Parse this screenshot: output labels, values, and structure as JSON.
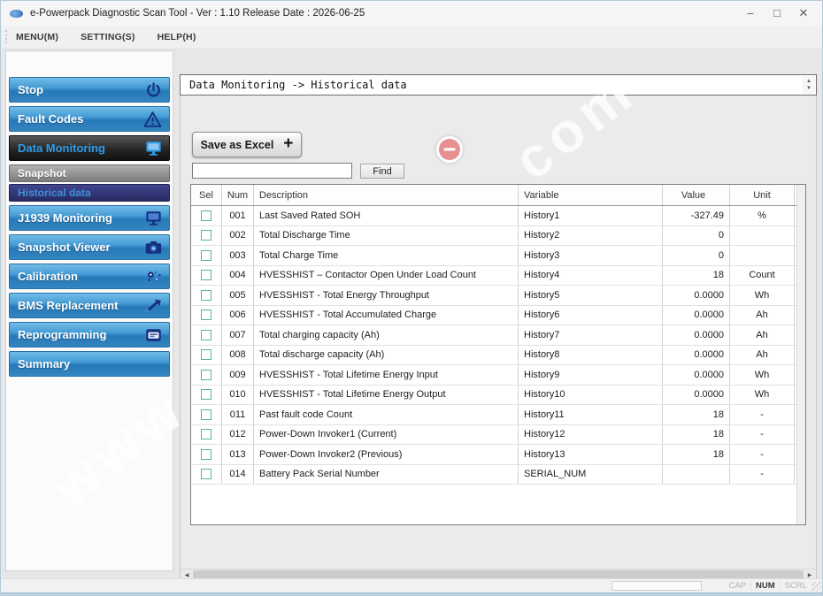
{
  "window": {
    "title": "e-Powerpack Diagnostic Scan Tool - Ver : 1.10 Release Date : 2026-06-25",
    "controls": {
      "minimize": "–",
      "maximize": "□",
      "close": "✕"
    }
  },
  "menu": {
    "items": [
      {
        "label": "MENU(M)"
      },
      {
        "label": "SETTING(S)"
      },
      {
        "label": "HELP(H)"
      }
    ]
  },
  "sidebar": {
    "items": [
      {
        "label": "Stop",
        "icon": "power-icon",
        "style": "blue",
        "selected": false
      },
      {
        "label": "Fault Codes",
        "icon": "warning-triangle-icon",
        "style": "blue",
        "selected": false
      },
      {
        "label": "Data Monitoring",
        "icon": "monitor-icon",
        "style": "dark-selected",
        "selected": true
      },
      {
        "label": "Snapshot",
        "icon": "",
        "style": "sub-gray",
        "selected": false
      },
      {
        "label": "Historical data",
        "icon": "",
        "style": "sub-navy-selected",
        "selected": true
      },
      {
        "label": "J1939 Monitoring",
        "icon": "monitor-icon",
        "style": "blue",
        "selected": false
      },
      {
        "label": "Snapshot Viewer",
        "icon": "camera-icon",
        "style": "blue",
        "selected": false
      },
      {
        "label": "Calibration",
        "icon": "gears-icon",
        "style": "blue",
        "selected": false
      },
      {
        "label": "BMS Replacement",
        "icon": "swap-arrows-icon",
        "style": "blue",
        "selected": false
      },
      {
        "label": "Reprogramming",
        "icon": "file-icon",
        "style": "blue",
        "selected": false
      },
      {
        "label": "Summary",
        "icon": "",
        "style": "blue",
        "selected": false
      }
    ]
  },
  "main": {
    "breadcrumb": "Data Monitoring -> Historical data",
    "save_button": {
      "label": "Save as Excel",
      "plus": "+"
    },
    "find": {
      "value": "",
      "button_label": "Find"
    },
    "annotation_badge": {
      "symbol": "minus"
    },
    "table": {
      "columns": [
        "Sel",
        "Num",
        "Description",
        "Variable",
        "Value",
        "Unit"
      ],
      "rows": [
        {
          "sel": false,
          "num": "001",
          "description": "Last Saved Rated SOH",
          "variable": "History1",
          "value": "-327.49",
          "unit": "%"
        },
        {
          "sel": false,
          "num": "002",
          "description": "Total Discharge Time",
          "variable": "History2",
          "value": "0",
          "unit": ""
        },
        {
          "sel": false,
          "num": "003",
          "description": "Total Charge Time",
          "variable": "History3",
          "value": "0",
          "unit": ""
        },
        {
          "sel": false,
          "num": "004",
          "description": "HVESSHIST – Contactor Open Under Load Count",
          "variable": "History4",
          "value": "18",
          "unit": "Count"
        },
        {
          "sel": false,
          "num": "005",
          "description": "HVESSHIST - Total Energy Throughput",
          "variable": "History5",
          "value": "0.0000",
          "unit": "Wh"
        },
        {
          "sel": false,
          "num": "006",
          "description": "HVESSHIST - Total Accumulated Charge",
          "variable": "History6",
          "value": "0.0000",
          "unit": "Ah"
        },
        {
          "sel": false,
          "num": "007",
          "description": "Total charging capacity (Ah)",
          "variable": "History7",
          "value": "0.0000",
          "unit": "Ah"
        },
        {
          "sel": false,
          "num": "008",
          "description": "Total discharge capacity (Ah)",
          "variable": "History8",
          "value": "0.0000",
          "unit": "Ah"
        },
        {
          "sel": false,
          "num": "009",
          "description": "HVESSHIST - Total Lifetime Energy Input",
          "variable": "History9",
          "value": "0.0000",
          "unit": "Wh"
        },
        {
          "sel": false,
          "num": "010",
          "description": "HVESSHIST - Total Lifetime Energy Output",
          "variable": "History10",
          "value": "0.0000",
          "unit": "Wh"
        },
        {
          "sel": false,
          "num": "011",
          "description": "Past fault code Count",
          "variable": "History11",
          "value": "18",
          "unit": "-"
        },
        {
          "sel": false,
          "num": "012",
          "description": "Power-Down Invoker1 (Current)",
          "variable": "History12",
          "value": "18",
          "unit": "-"
        },
        {
          "sel": false,
          "num": "013",
          "description": "Power-Down Invoker2 (Previous)",
          "variable": "History13",
          "value": "18",
          "unit": "-"
        },
        {
          "sel": false,
          "num": "014",
          "description": "Battery Pack Serial Number",
          "variable": "SERIAL_NUM",
          "value": "",
          "unit": "-"
        }
      ]
    }
  },
  "status_bar": {
    "indicators": [
      {
        "label": "CAP",
        "active": false
      },
      {
        "label": "NUM",
        "active": true
      },
      {
        "label": "SCRL",
        "active": false
      }
    ]
  },
  "watermark": {
    "fragments": [
      "www",
      "com"
    ]
  },
  "colors": {
    "sidebar_blue": "#3d93cd",
    "selected_text_blue": "#2f9ce8",
    "sub_navy": "#2b2f6a",
    "badge_pink": "#e89090",
    "checkbox_teal": "#55b3a2"
  }
}
